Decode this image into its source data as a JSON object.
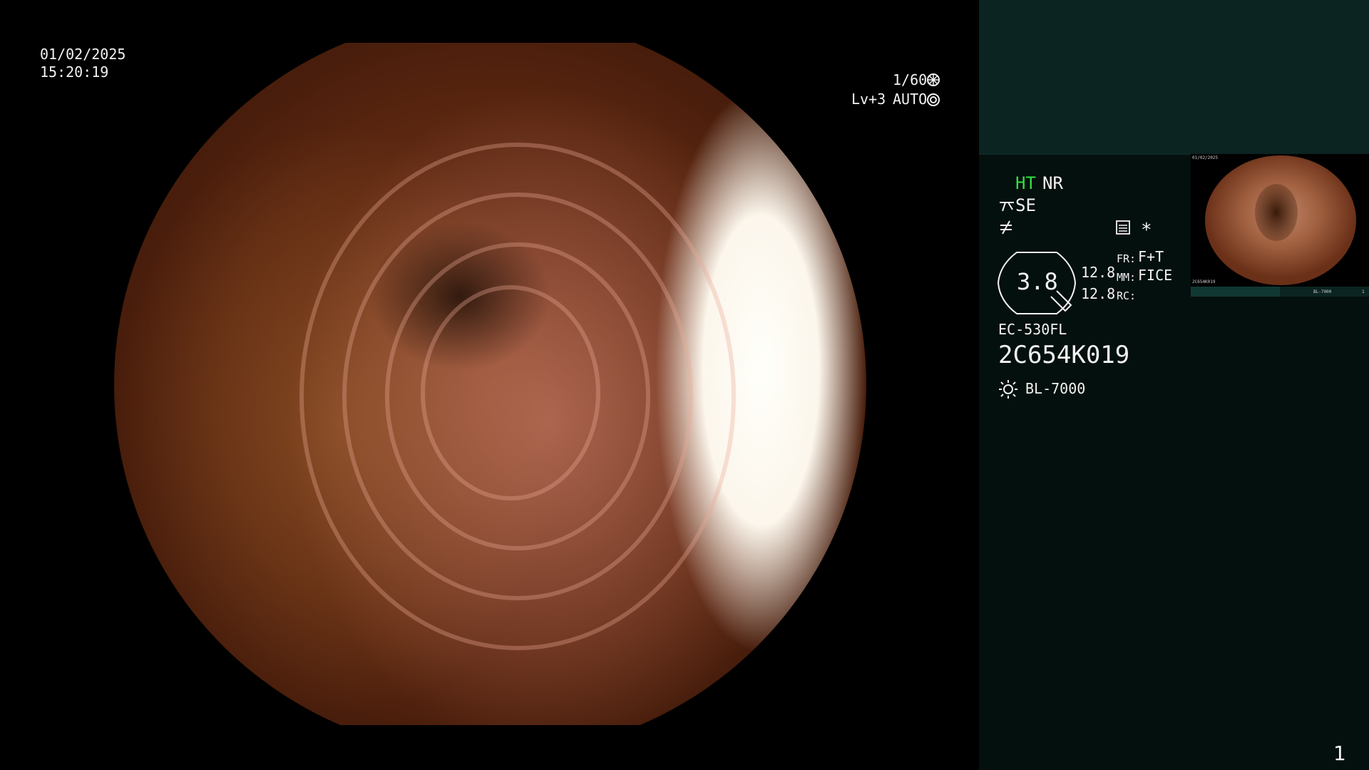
{
  "overlay": {
    "date": "01/02/2025",
    "time": "15:20:19",
    "shutter": "1/60",
    "level": "Lv+3",
    "iris_mode": "AUTO"
  },
  "panel": {
    "ht_label": "HT",
    "nr_label": "NR",
    "se_label": "SE",
    "zoom_value": "3.8",
    "val_1": "12.8",
    "val_2": "12.8",
    "fr_label": "FR:",
    "fr_value": "F+T",
    "mm_label": "MM:",
    "mm_value": "FICE",
    "rc_label": "RC:",
    "scope_model": "EC-530FL",
    "serial": "2C654K019",
    "light_source": "BL-7000",
    "asterisk": "*",
    "page_number": "1"
  },
  "thumbnail": {
    "date": "01/02/2025",
    "serial": "2C654K019",
    "light": "BL-7000",
    "page": "1"
  },
  "colors": {
    "panel_bg": "#04100e",
    "panel_top_bg": "#0b2421",
    "accent_green": "#33e040"
  },
  "icons": [
    "shutter-icon",
    "iris-icon",
    "scissors-icon",
    "not-equal-icon",
    "settings-icon",
    "magnify-icon",
    "sun-icon"
  ]
}
